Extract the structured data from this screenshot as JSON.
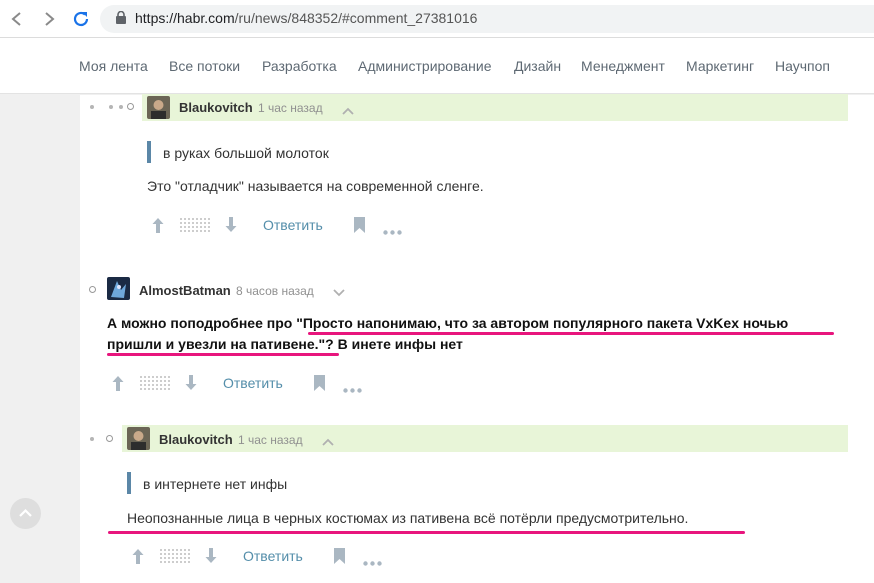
{
  "browser": {
    "url_host": "https://habr.com",
    "url_path": "/ru/news/848352/#comment_27381016"
  },
  "nav": [
    "Моя лента",
    "Все потоки",
    "Разработка",
    "Администрирование",
    "Дизайн",
    "Менеджмент",
    "Маркетинг",
    "Научпоп"
  ],
  "comments": [
    {
      "user": "Blaukovitch",
      "time": "1 час назад",
      "quote": "в руках большой молоток",
      "text": "Это \"отладчик\" называется на современной сленге.",
      "reply": "Ответить"
    },
    {
      "user": "AlmostBatman",
      "time": "8 часов назад",
      "text_line1": "А можно поподробнее про \"Просто напонимаю, что за автором популярного пакета VxKex ночью",
      "text_line2": "пришли и увезли на пативене.\"? В инете инфы нет",
      "reply": "Ответить"
    },
    {
      "user": "Blaukovitch",
      "time": "1 час назад",
      "quote": "в интернете нет инфы",
      "text": "Неопознанные лица в черных костюмах из пативена всё потёрли предусмотрительно.",
      "reply": "Ответить"
    }
  ],
  "colors": {
    "highlight": "#e8f5d8",
    "link": "#548eaa",
    "quote_bar": "#5b87a7",
    "underline_annotation": "#e8157d"
  },
  "icons": [
    "back-arrow-icon",
    "forward-arrow-icon",
    "reload-icon",
    "lock-icon",
    "vote-up-icon",
    "vote-down-icon",
    "bookmark-icon",
    "more-icon",
    "chevron-up-icon",
    "chevron-down-icon",
    "scroll-top-icon"
  ]
}
